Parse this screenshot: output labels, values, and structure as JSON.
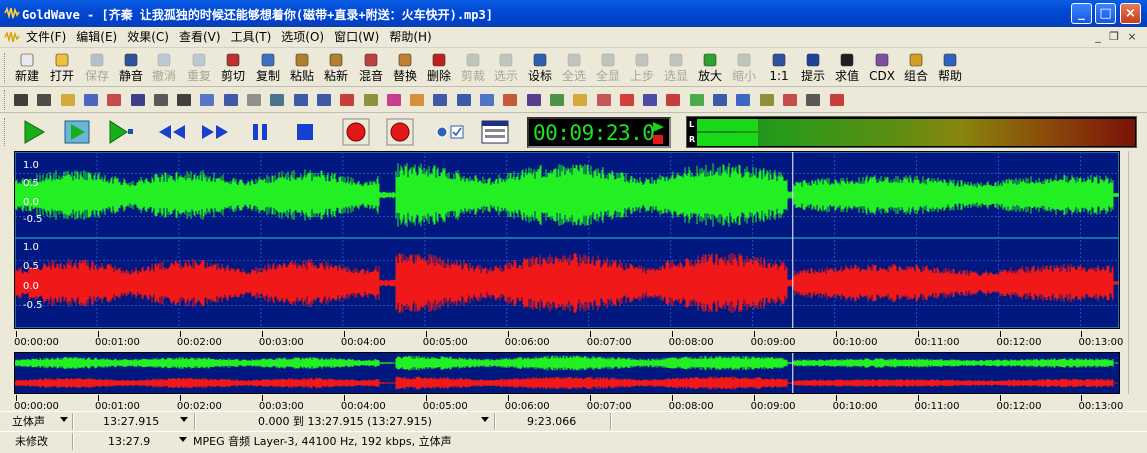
{
  "window": {
    "app_name": "GoldWave",
    "title": "GoldWave - [齐秦 让我孤独的时候还能够想着你(磁带+直录+附送：火车快开).mp3]",
    "minimize_glyph": "_",
    "maximize_glyph": "□",
    "close_glyph": "×"
  },
  "menu": {
    "items": [
      "文件(F)",
      "编辑(E)",
      "效果(C)",
      "查看(V)",
      "工具(T)",
      "选项(O)",
      "窗口(W)",
      "帮助(H)"
    ],
    "mdi_min": "_",
    "mdi_restore": "❐",
    "mdi_close": "×"
  },
  "toolbar": {
    "buttons": [
      {
        "label": "新建",
        "icon": "new-icon",
        "enabled": true
      },
      {
        "label": "打开",
        "icon": "open-icon",
        "enabled": true
      },
      {
        "label": "保存",
        "icon": "save-icon",
        "enabled": false
      },
      {
        "label": "静音",
        "icon": "mute-icon",
        "enabled": true
      },
      {
        "label": "撤消",
        "icon": "undo-icon",
        "enabled": false
      },
      {
        "label": "重复",
        "icon": "redo-icon",
        "enabled": false
      },
      {
        "label": "剪切",
        "icon": "cut-icon",
        "enabled": true
      },
      {
        "label": "复制",
        "icon": "copy-icon",
        "enabled": true
      },
      {
        "label": "粘贴",
        "icon": "paste-icon",
        "enabled": true
      },
      {
        "label": "粘新",
        "icon": "paste-new-icon",
        "enabled": true
      },
      {
        "label": "混音",
        "icon": "mix-icon",
        "enabled": true
      },
      {
        "label": "替换",
        "icon": "replace-icon",
        "enabled": true
      },
      {
        "label": "删除",
        "icon": "delete-icon",
        "enabled": true
      },
      {
        "label": "剪裁",
        "icon": "trim-icon",
        "enabled": false
      },
      {
        "label": "选示",
        "icon": "select-view-icon",
        "enabled": false
      },
      {
        "label": "设标",
        "icon": "set-marker-icon",
        "enabled": true
      },
      {
        "label": "全选",
        "icon": "select-all-icon",
        "enabled": false
      },
      {
        "label": "全显",
        "icon": "show-all-icon",
        "enabled": false
      },
      {
        "label": "上步",
        "icon": "previous-icon",
        "enabled": false
      },
      {
        "label": "选显",
        "icon": "show-selection-icon",
        "enabled": false
      },
      {
        "label": "放大",
        "icon": "zoom-in-icon",
        "enabled": true
      },
      {
        "label": "缩小",
        "icon": "zoom-out-icon",
        "enabled": false
      },
      {
        "label": "1:1",
        "icon": "zoom-1to1-icon",
        "enabled": true
      },
      {
        "label": "提示",
        "icon": "cue-icon",
        "enabled": true
      },
      {
        "label": "求值",
        "icon": "evaluate-icon",
        "enabled": true
      },
      {
        "label": "CDX",
        "icon": "cd-extract-icon",
        "enabled": true
      },
      {
        "label": "组合",
        "icon": "combine-icon",
        "enabled": true
      },
      {
        "label": "帮助",
        "icon": "help-icon",
        "enabled": true
      }
    ]
  },
  "transport": {
    "time": "00:09:23.0"
  },
  "meter": {
    "left_label": "L",
    "right_label": "R",
    "level_left": 0.14,
    "level_right": 0.14
  },
  "waveform": {
    "y_labels_top": [
      "1.0",
      "0.5",
      "0.0",
      "-0.5"
    ],
    "y_labels_bottom": [
      "1.0",
      "0.5",
      "0.0",
      "-0.5"
    ],
    "colors": {
      "left": "#22f022",
      "right": "#f01818",
      "background": "#001880"
    },
    "playhead_fraction": 0.7045
  },
  "ruler": {
    "labels": [
      "00:00:00",
      "00:01:00",
      "00:02:00",
      "00:03:00",
      "00:04:00",
      "00:05:00",
      "00:06:00",
      "00:07:00",
      "00:08:00",
      "00:09:00",
      "00:10:00",
      "00:11:00",
      "00:12:00",
      "00:13:00"
    ]
  },
  "status": {
    "channel": "立体声",
    "duration": "13:27.915",
    "selection": "0.000 到 13:27.915 (13:27.915)",
    "position": "9:23.066",
    "modified": "未修改",
    "total": "13:27.9",
    "format": "MPEG 音频 Layer-3, 44100 Hz, 192 kbps, 立体声"
  }
}
